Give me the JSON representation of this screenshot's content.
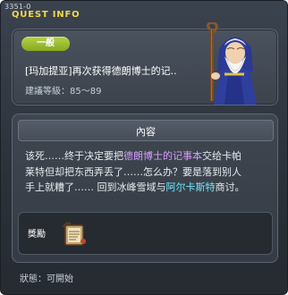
{
  "window": {
    "quest_id": "3351-0",
    "title": "QUEST INFO"
  },
  "info": {
    "badge": "一般",
    "quest_name": "[玛加提亚]再次获得德朗博士的记..",
    "level": "建議等級：85～89"
  },
  "content": {
    "header": "內容",
    "lines": [
      [
        "该死……终于决定要把",
        "德朗博士的记事本",
        "交给卡帕"
      ],
      [
        "莱特但却把东西弄丢了……怎么办？要是落到别人"
      ],
      [
        "手上就糟了……  回到冰峰雪域与",
        "阿尔卡斯特",
        "商讨。"
      ]
    ]
  },
  "reward": {
    "label": "獎勵",
    "icon": "scroll-icon"
  },
  "status": {
    "text": "狀態：可開始"
  },
  "colors": {
    "title": "#f0d94a",
    "badge": "#9fbf33",
    "highlight_item": "#d79cff",
    "highlight_npc": "#6fe6ff"
  }
}
